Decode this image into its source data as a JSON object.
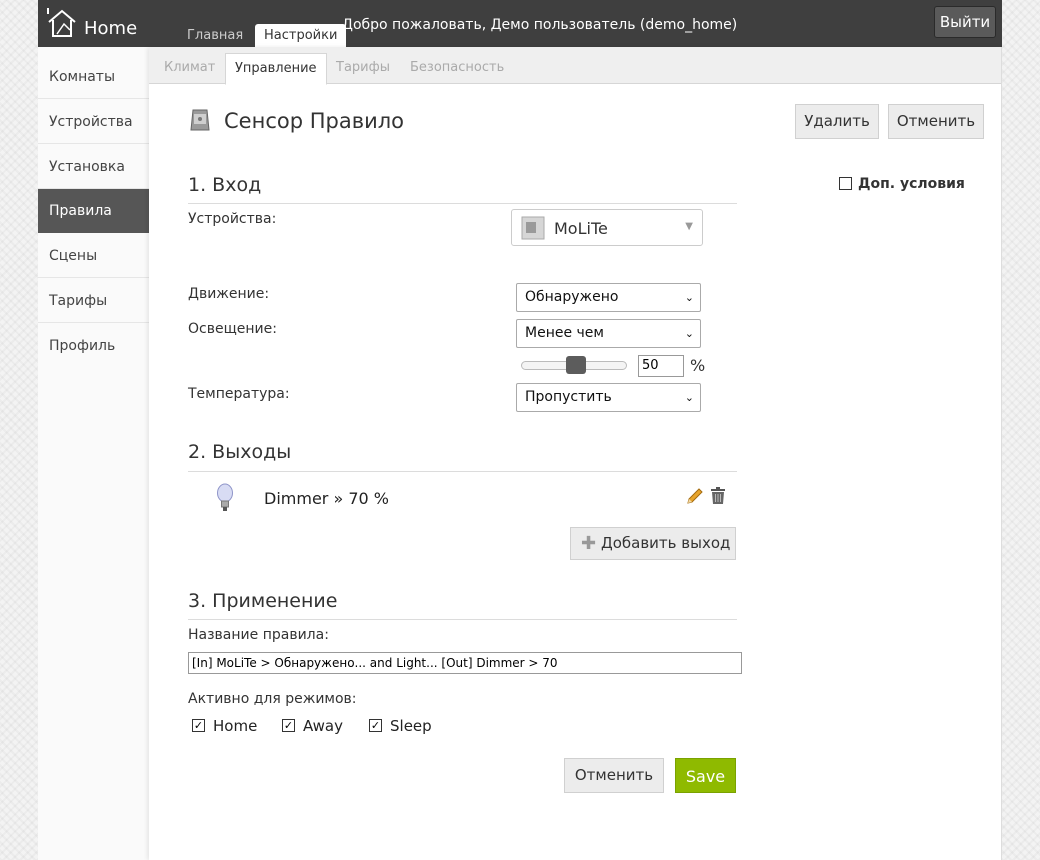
{
  "header": {
    "logo_text": "Home",
    "tabs": [
      "Главная",
      "Настройки"
    ],
    "welcome": "Добро пожаловать, Демо пользователь (demo_home)",
    "logout": "Выйти"
  },
  "sidebar": {
    "items": [
      "Комнаты",
      "Устройства",
      "Установка",
      "Правила",
      "Сцены",
      "Тарифы",
      "Профиль"
    ],
    "active": "Правила"
  },
  "subtabs": [
    "Климат",
    "Управление",
    "Тарифы",
    "Безопасность"
  ],
  "page": {
    "title": "Сенсор Правило",
    "delete": "Удалить",
    "cancel": "Отменить",
    "extra_conditions": "Доп. условия"
  },
  "input": {
    "heading": "1. Вход",
    "devices_label": "Устройства:",
    "device_value": "MoLiTe",
    "motion_label": "Движение:",
    "motion_value": "Обнаружено",
    "light_label": "Освещение:",
    "light_value": "Менее чем",
    "light_percent": "50",
    "light_unit": "%",
    "temp_label": "Температура:",
    "temp_value": "Пропустить"
  },
  "outputs": {
    "heading": "2. Выходы",
    "items": [
      {
        "text": "Dimmer » 70 %"
      }
    ],
    "add": "Добавить выход"
  },
  "apply": {
    "heading": "3. Применение",
    "name_label": "Название правила:",
    "name_value": "[In] MoLiTe > Обнаружено... and Light...  [Out] Dimmer > 70",
    "modes_label": "Активно для режимов:",
    "modes": [
      {
        "label": "Home",
        "checked": true
      },
      {
        "label": "Away",
        "checked": true
      },
      {
        "label": "Sleep",
        "checked": true
      }
    ],
    "cancel": "Отменить",
    "save": "Save"
  },
  "colors": {
    "save": "#8fba00",
    "active": "#565656",
    "topbar": "#3f3f3f"
  }
}
